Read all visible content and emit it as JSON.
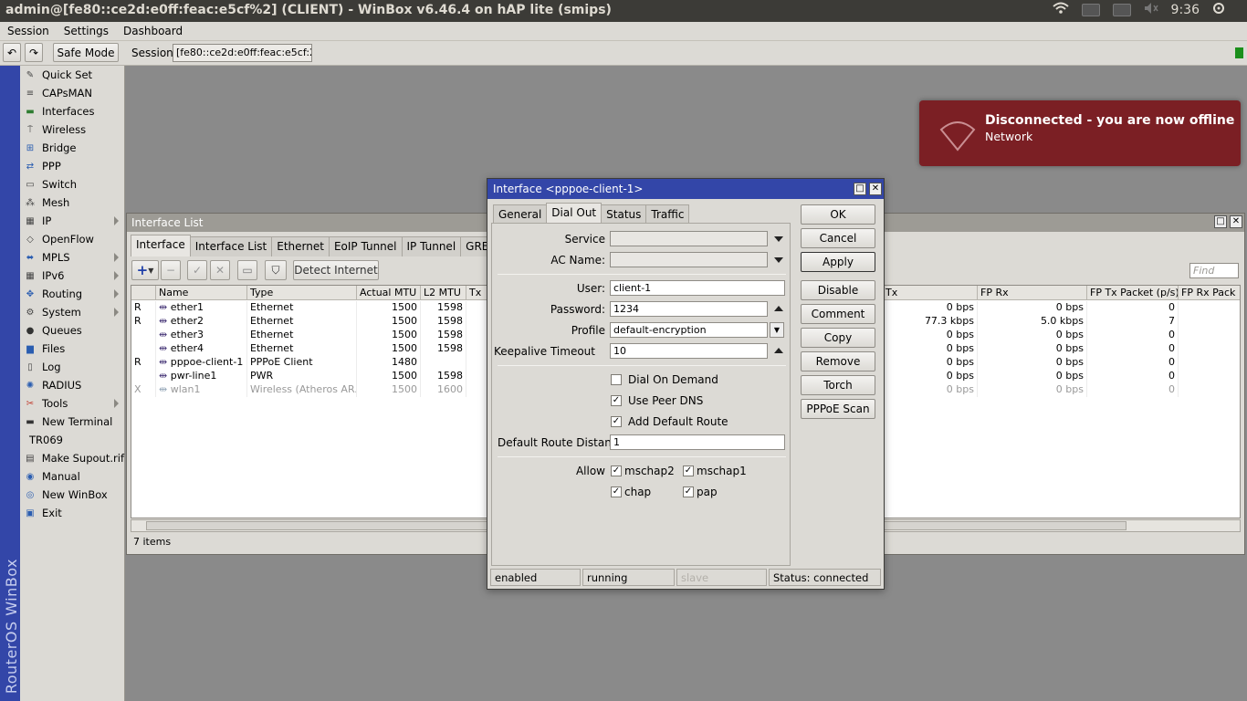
{
  "topbar": {
    "title": "admin@[fe80::ce2d:e0ff:feac:e5cf%2] (CLIENT) - WinBox v6.46.4 on hAP lite (smips)",
    "clock": "9:36"
  },
  "menu": [
    "Session",
    "Settings",
    "Dashboard"
  ],
  "toolbar": {
    "safe_mode": "Safe Mode",
    "session_label": "Session:",
    "session_value": "[fe80::ce2d:e0ff:feac:e5cf:2]"
  },
  "brand": "RouterOS WinBox",
  "sidebar": [
    {
      "label": "Quick Set",
      "icon": "quick-set-icon",
      "sub": false
    },
    {
      "label": "CAPsMAN",
      "icon": "capsman-icon",
      "sub": false
    },
    {
      "label": "Interfaces",
      "icon": "interfaces-icon",
      "sub": false
    },
    {
      "label": "Wireless",
      "icon": "wireless-icon",
      "sub": false
    },
    {
      "label": "Bridge",
      "icon": "bridge-icon",
      "sub": false
    },
    {
      "label": "PPP",
      "icon": "ppp-icon",
      "sub": false
    },
    {
      "label": "Switch",
      "icon": "switch-icon",
      "sub": false
    },
    {
      "label": "Mesh",
      "icon": "mesh-icon",
      "sub": false
    },
    {
      "label": "IP",
      "icon": "ip-icon",
      "sub": true
    },
    {
      "label": "OpenFlow",
      "icon": "openflow-icon",
      "sub": false
    },
    {
      "label": "MPLS",
      "icon": "mpls-icon",
      "sub": true
    },
    {
      "label": "IPv6",
      "icon": "ipv6-icon",
      "sub": true
    },
    {
      "label": "Routing",
      "icon": "routing-icon",
      "sub": true
    },
    {
      "label": "System",
      "icon": "system-icon",
      "sub": true
    },
    {
      "label": "Queues",
      "icon": "queues-icon",
      "sub": false
    },
    {
      "label": "Files",
      "icon": "files-icon",
      "sub": false
    },
    {
      "label": "Log",
      "icon": "log-icon",
      "sub": false
    },
    {
      "label": "RADIUS",
      "icon": "radius-icon",
      "sub": false
    },
    {
      "label": "Tools",
      "icon": "tools-icon",
      "sub": true
    },
    {
      "label": "New Terminal",
      "icon": "terminal-icon",
      "sub": false
    },
    {
      "label": "TR069",
      "icon": "",
      "sub": false
    },
    {
      "label": "Make Supout.rif",
      "icon": "supout-icon",
      "sub": false
    },
    {
      "label": "Manual",
      "icon": "manual-icon",
      "sub": false
    },
    {
      "label": "New WinBox",
      "icon": "winbox-icon",
      "sub": false
    },
    {
      "label": "Exit",
      "icon": "exit-icon",
      "sub": false
    }
  ],
  "notification": {
    "title": "Disconnected - you are now offline",
    "subtitle": "Network"
  },
  "iflist": {
    "title": "Interface List",
    "tabs": [
      "Interface",
      "Interface List",
      "Ethernet",
      "EoIP Tunnel",
      "IP Tunnel",
      "GRE Tunn"
    ],
    "detect_label": "Detect Internet",
    "find_placeholder": "Find",
    "columns_left": [
      "Name",
      "Type",
      "Actual MTU",
      "L2 MTU",
      "Tx"
    ],
    "columns_right": [
      "Tx",
      "FP Rx",
      "FP Tx Packet (p/s)",
      "FP Rx Pack"
    ],
    "rows": [
      {
        "flag": "R",
        "name": "ether1",
        "type": "Ethernet",
        "mtu": "1500",
        "l2mtu": "1598",
        "tx": "0 bps",
        "fprx": "0 bps",
        "fptxp": "0",
        "disabled": false
      },
      {
        "flag": "R",
        "name": "ether2",
        "type": "Ethernet",
        "mtu": "1500",
        "l2mtu": "1598",
        "tx": "77.3 kbps",
        "fprx": "5.0 kbps",
        "fptxp": "7",
        "disabled": false
      },
      {
        "flag": "",
        "name": "ether3",
        "type": "Ethernet",
        "mtu": "1500",
        "l2mtu": "1598",
        "tx": "0 bps",
        "fprx": "0 bps",
        "fptxp": "0",
        "disabled": false
      },
      {
        "flag": "",
        "name": "ether4",
        "type": "Ethernet",
        "mtu": "1500",
        "l2mtu": "1598",
        "tx": "0 bps",
        "fprx": "0 bps",
        "fptxp": "0",
        "disabled": false
      },
      {
        "flag": "R",
        "name": "pppoe-client-1",
        "type": "PPPoE Client",
        "mtu": "1480",
        "l2mtu": "",
        "tx": "0 bps",
        "fprx": "0 bps",
        "fptxp": "0",
        "disabled": false
      },
      {
        "flag": "",
        "name": "pwr-line1",
        "type": "PWR",
        "mtu": "1500",
        "l2mtu": "1598",
        "tx": "0 bps",
        "fprx": "0 bps",
        "fptxp": "0",
        "disabled": false
      },
      {
        "flag": "X",
        "name": "wlan1",
        "type": "Wireless (Atheros AR...",
        "mtu": "1500",
        "l2mtu": "1600",
        "tx": "0 bps",
        "fprx": "0 bps",
        "fptxp": "0",
        "disabled": true
      }
    ],
    "items_count": "7 items"
  },
  "dialog": {
    "title": "Interface <pppoe-client-1>",
    "tabs": [
      "General",
      "Dial Out",
      "Status",
      "Traffic"
    ],
    "active_tab": 1,
    "fields": {
      "service_label": "Service",
      "acname_label": "AC Name:",
      "user_label": "User:",
      "user_value": "client-1",
      "password_label": "Password:",
      "password_value": "1234",
      "profile_label": "Profile",
      "profile_value": "default-encryption",
      "keepalive_label": "Keepalive Timeout",
      "keepalive_value": "10",
      "dial_on_demand": "Dial On Demand",
      "use_peer_dns": "Use Peer DNS",
      "add_default_route": "Add Default Route",
      "default_route_distance_label": "Default Route Distance",
      "default_route_distance_value": "1",
      "allow_label": "Allow",
      "mschap2": "mschap2",
      "mschap1": "mschap1",
      "chap": "chap",
      "pap": "pap"
    },
    "checks": {
      "dial_on_demand": false,
      "use_peer_dns": true,
      "add_default_route": true,
      "mschap2": true,
      "mschap1": true,
      "chap": true,
      "pap": true
    },
    "buttons": [
      "OK",
      "Cancel",
      "Apply",
      "Disable",
      "Comment",
      "Copy",
      "Remove",
      "Torch",
      "PPPoE Scan"
    ],
    "status": [
      "enabled",
      "running",
      "slave",
      "Status: connected"
    ]
  }
}
